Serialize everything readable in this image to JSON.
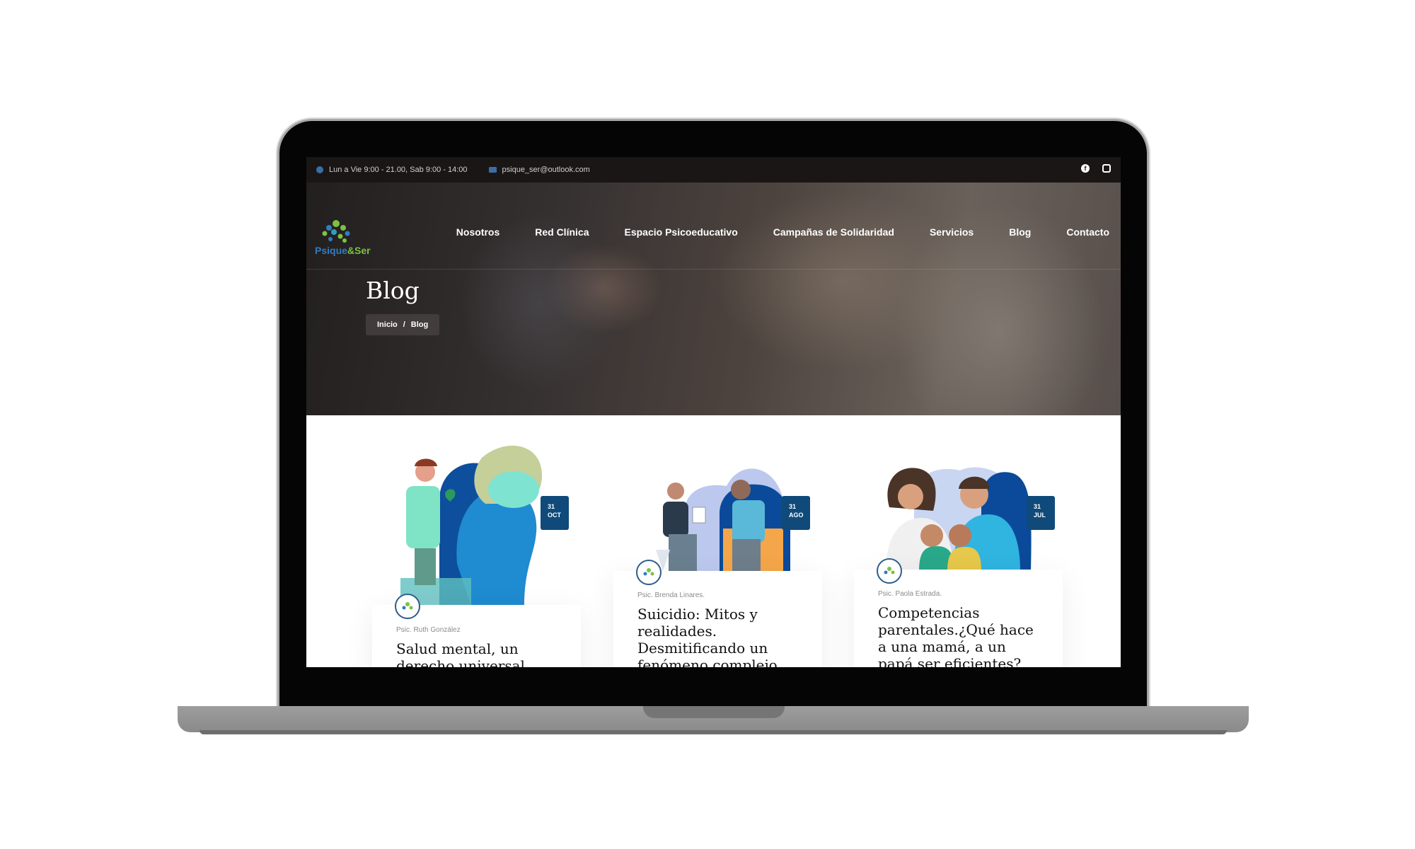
{
  "topbar": {
    "hours": "Lun a Vie 9:00 - 21.00, Sab 9:00 - 14:00",
    "email": "psique_ser@outlook.com",
    "social": [
      "facebook-icon",
      "instagram-icon"
    ]
  },
  "brand": {
    "name_part1": "Psique",
    "name_part2": "&Ser"
  },
  "nav": [
    "Nosotros",
    "Red Clínica",
    "Espacio Psicoeducativo",
    "Campañas de Solidaridad",
    "Servicios",
    "Blog",
    "Contacto"
  ],
  "hero": {
    "title": "Blog",
    "breadcrumb_home": "Inicio",
    "breadcrumb_sep": "/",
    "breadcrumb_current": "Blog"
  },
  "posts": [
    {
      "day": "31",
      "month": "OCT",
      "author": "Psic. Ruth González",
      "title": "Salud mental, un derecho universal"
    },
    {
      "day": "31",
      "month": "AGO",
      "author": "Psic. Brenda Linares.",
      "title": "Suicidio: Mitos y realidades. Desmitificando un fenómeno complejo"
    },
    {
      "day": "31",
      "month": "JUL",
      "author": "Psic. Paola Estrada.",
      "title": "Competencias parentales.¿Qué hace a una mamá, a un papá ser eficientes?"
    }
  ],
  "colors": {
    "accent": "#0f4a7a",
    "topbar": "#1b1616",
    "brand_green": "#7cc242",
    "brand_blue": "#2f7dc0"
  }
}
